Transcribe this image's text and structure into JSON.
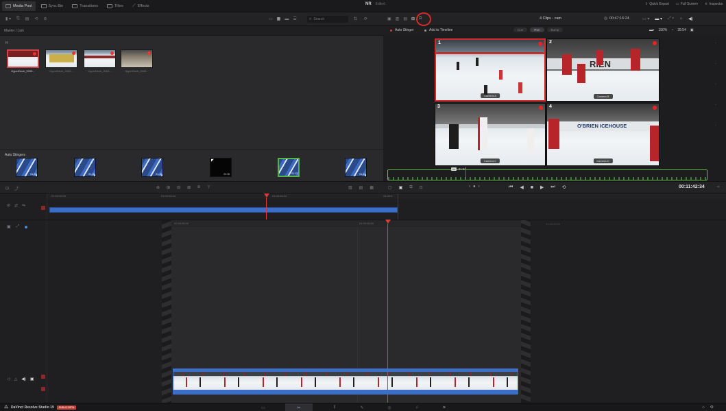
{
  "topbar": {
    "tabs": [
      {
        "label": "Media Pool",
        "active": true
      },
      {
        "label": "Sync Bin",
        "active": false
      },
      {
        "label": "Transitions",
        "active": false
      },
      {
        "label": "Titles",
        "active": false
      },
      {
        "label": "Effects",
        "active": false
      }
    ],
    "project_title": "NR",
    "project_status": "Edited",
    "right_items": [
      "Quick Export",
      "Full Screen",
      "Inspector"
    ]
  },
  "media_pool": {
    "search_placeholder": "Search",
    "path": "Master / cam",
    "bin_label": "H",
    "clips": [
      {
        "name": "HyperDeck_0003..."
      },
      {
        "name": "HyperDeck_0003..."
      },
      {
        "name": "HyperDeck_0003..."
      },
      {
        "name": "HyperDeck_0003..."
      }
    ]
  },
  "stingers": {
    "label": "Auto Stingers",
    "durations": [
      "01:13",
      "01:16",
      "01:16",
      "00:38",
      "01:13",
      "01:14"
    ]
  },
  "viewer": {
    "timecode_left": "00:47:16:24",
    "clip_title": "4 Clips - cam",
    "zoom": "150%",
    "timecode_right": "35:54",
    "options": {
      "auto_stinger": "Auto Stinger",
      "add_to_timeline": "Add to Timeline"
    },
    "buttons": [
      "Cue",
      "Run",
      "Bump"
    ],
    "cameras": [
      {
        "num": "1",
        "label": "Camera A"
      },
      {
        "num": "2",
        "label": "Camera B"
      },
      {
        "num": "3",
        "label": "Camera C"
      },
      {
        "num": "4",
        "label": "Camera D"
      }
    ],
    "scrub_marker": "01:53"
  },
  "transport": {
    "timecode": "00:11:42:34"
  },
  "timeline": {
    "upper_ruler": [
      "01:00:00:00",
      "01:00:02:24",
      "01:00:04:24",
      "01:00:0"
    ],
    "lower_ruler": [
      "01:00:05:00",
      "01:00:06:00"
    ],
    "lower_ruler_right": "01:00:09:00"
  },
  "bottombar": {
    "app_name": "DaVinci Resolve Studio 19",
    "badge": "PUBLIC BETA"
  },
  "colors": {
    "accent_blue": "#3b6fc7",
    "playhead_red": "#e03a3a",
    "highlight_circle": "#d42a2a"
  }
}
